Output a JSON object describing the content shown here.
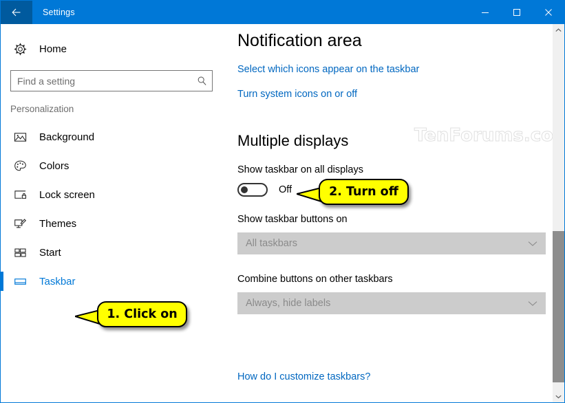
{
  "window": {
    "title": "Settings",
    "accent_color": "#0078d7",
    "back_icon": "back-arrow-icon",
    "controls": {
      "minimize": "minimize-icon",
      "maximize": "maximize-icon",
      "close": "close-icon"
    }
  },
  "sidebar": {
    "home": {
      "label": "Home",
      "icon": "gear-icon"
    },
    "search": {
      "placeholder": "Find a setting",
      "value": "",
      "icon": "search-icon"
    },
    "section_label": "Personalization",
    "items": [
      {
        "label": "Background",
        "icon": "picture-icon",
        "selected": false
      },
      {
        "label": "Colors",
        "icon": "palette-icon",
        "selected": false
      },
      {
        "label": "Lock screen",
        "icon": "lock-screen-icon",
        "selected": false
      },
      {
        "label": "Themes",
        "icon": "themes-icon",
        "selected": false
      },
      {
        "label": "Start",
        "icon": "start-icon",
        "selected": false
      },
      {
        "label": "Taskbar",
        "icon": "taskbar-icon",
        "selected": true
      }
    ]
  },
  "main": {
    "notification_area": {
      "heading": "Notification area",
      "links": [
        "Select which icons appear on the taskbar",
        "Turn system icons on or off"
      ]
    },
    "multiple_displays": {
      "heading": "Multiple displays",
      "show_taskbar_all_displays": {
        "label": "Show taskbar on all displays",
        "state": "Off",
        "checked": false
      },
      "show_taskbar_buttons_on": {
        "label": "Show taskbar buttons on",
        "value": "All taskbars",
        "disabled": true,
        "chevron": "chevron-down-icon"
      },
      "combine_buttons": {
        "label": "Combine buttons on other taskbars",
        "value": "Always, hide labels",
        "disabled": true,
        "chevron": "chevron-down-icon"
      }
    },
    "help_link": "How do I customize taskbars?"
  },
  "watermark": "TenForums.com",
  "callouts": [
    {
      "text": "1. Click on",
      "target": "sidebar-item-taskbar"
    },
    {
      "text": "2. Turn off",
      "target": "show-taskbar-all-displays-toggle"
    }
  ],
  "scrollbar": {
    "up_icon": "chevron-up-icon",
    "down_icon": "chevron-down-icon",
    "thumb_color": "#8d8d8d"
  }
}
